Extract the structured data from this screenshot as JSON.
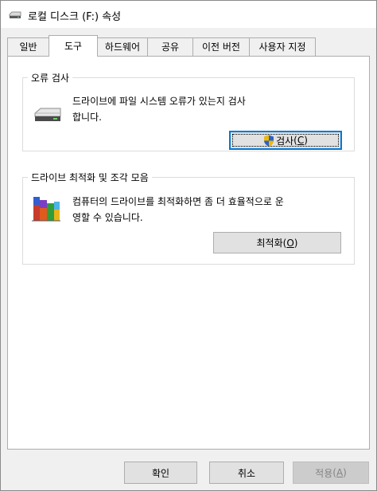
{
  "window": {
    "title": "로컬 디스크 (F:) 속성"
  },
  "tabs": [
    {
      "label": "일반",
      "active": false
    },
    {
      "label": "도구",
      "active": true
    },
    {
      "label": "하드웨어",
      "active": false
    },
    {
      "label": "공유",
      "active": false
    },
    {
      "label": "이전 버전",
      "active": false
    },
    {
      "label": "사용자 지정",
      "active": false
    }
  ],
  "error_check": {
    "title": "오류 검사",
    "icon": "drive-icon",
    "description_line1": "드라이브에 파일 시스템 오류가 있는지 검사",
    "description_line2": "합니다.",
    "button_text": "검사",
    "button_hotkey_prefix": "(",
    "button_hotkey": "C",
    "button_hotkey_suffix": ")",
    "button_icon": "uac-shield-icon"
  },
  "optimize": {
    "title": "드라이브 최적화 및 조각 모음",
    "icon": "defrag-icon",
    "description_line1": "컴퓨터의 드라이브를 최적화하면 좀 더 효율적으로 운",
    "description_line2": "영할 수 있습니다.",
    "button_text": "최적화",
    "button_hotkey_prefix": "(",
    "button_hotkey": "O",
    "button_hotkey_suffix": ")"
  },
  "footer": {
    "ok_label": "확인",
    "cancel_label": "취소",
    "apply_text": "적용",
    "apply_hotkey_prefix": "(",
    "apply_hotkey": "A",
    "apply_hotkey_suffix": ")",
    "apply_enabled": false
  },
  "colors": {
    "dialog_bg": "#f0f0f0",
    "content_bg": "#ffffff",
    "focus_border": "#0078d7",
    "disabled_text": "#838383"
  }
}
